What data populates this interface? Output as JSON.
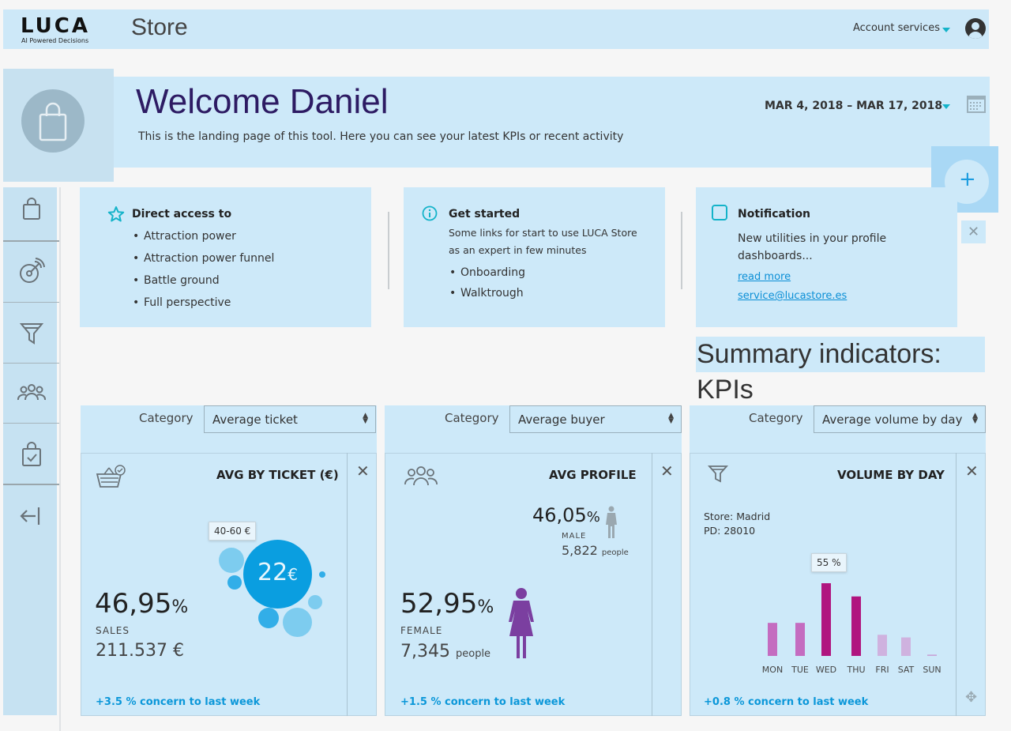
{
  "header": {
    "logo": "LUCA",
    "logo_tagline": "AI Powered Decisions",
    "app_title": "Store",
    "account_label": "Account services"
  },
  "welcome": {
    "title": "Welcome Daniel",
    "subtitle": "This is the landing page of this tool. Here you can see your latest KPIs or recent activity",
    "date_range": "MAR 4, 2018 – MAR 17, 2018"
  },
  "sidebar": {
    "items": [
      {
        "icon": "shopping-bag-icon"
      },
      {
        "icon": "radar-icon"
      },
      {
        "icon": "funnel-icon"
      },
      {
        "icon": "people-icon"
      },
      {
        "icon": "bag-check-icon"
      },
      {
        "icon": "logout-icon"
      }
    ]
  },
  "cards": {
    "direct": {
      "title": "Direct access to",
      "items": [
        "Attraction power",
        "Attraction power funnel",
        "Battle ground",
        "Full perspective"
      ]
    },
    "started": {
      "title": "Get started",
      "text_line1": "Some links for start to use LUCA Store",
      "text_line2": "as an expert in few minutes",
      "items": [
        "Onboarding",
        "Walktrough"
      ]
    },
    "notification": {
      "title": "Notification",
      "text_line1": "New utilities in your profile",
      "text_line2": "dashboards...",
      "link1": "read more",
      "link2": "service@lucastore.es"
    }
  },
  "summary_title": "Summary indicators: KPIs",
  "kpis": [
    {
      "category_label": "Category",
      "select_value": "Average ticket",
      "title": "AVG BY TICKET (€)",
      "big_value": "46,95",
      "big_unit": "%",
      "label": "SALES",
      "value": "211.537 €",
      "tooltip": "40-60 €",
      "bubble_value": "22",
      "bubble_unit": "€",
      "concern": "+3.5 % concern to last week"
    },
    {
      "category_label": "Category",
      "select_value": "Average buyer",
      "title": "AVG PROFILE",
      "male_pct": "46,05",
      "male_unit": "%",
      "male_label": "MALE",
      "male_people": "5,822",
      "people_word": "people",
      "female_pct": "52,95",
      "female_unit": "%",
      "female_label": "FEMALE",
      "female_people": "7,345",
      "concern": "+1.5 % concern to last week"
    },
    {
      "category_label": "Category",
      "select_value": "Average volume by day",
      "title": "VOLUME BY DAY",
      "store": "Store: Madrid",
      "pd": "PD: 28010",
      "tooltip": "55 %",
      "concern": "+0.8 % concern to last week"
    }
  ],
  "chart_data": {
    "type": "bar",
    "categories": [
      "MON",
      "TUE",
      "WED",
      "THU",
      "FRI",
      "SAT",
      "SUN"
    ],
    "values": [
      25,
      25,
      55,
      45,
      16,
      14,
      1
    ],
    "colors": [
      "#c46cc0",
      "#c46cc0",
      "#b0157f",
      "#b0157f",
      "#cfb2df",
      "#cfb2df",
      "#c8a5d8"
    ],
    "ylim": [
      0,
      55
    ]
  },
  "colors": {
    "accent": "#14b3c9",
    "link": "#0b8fd6",
    "bubble_primary": "#0a9ee0",
    "bubble_light": "#7dccef",
    "female": "#7b3fa0",
    "male": "#9aa8b0"
  }
}
